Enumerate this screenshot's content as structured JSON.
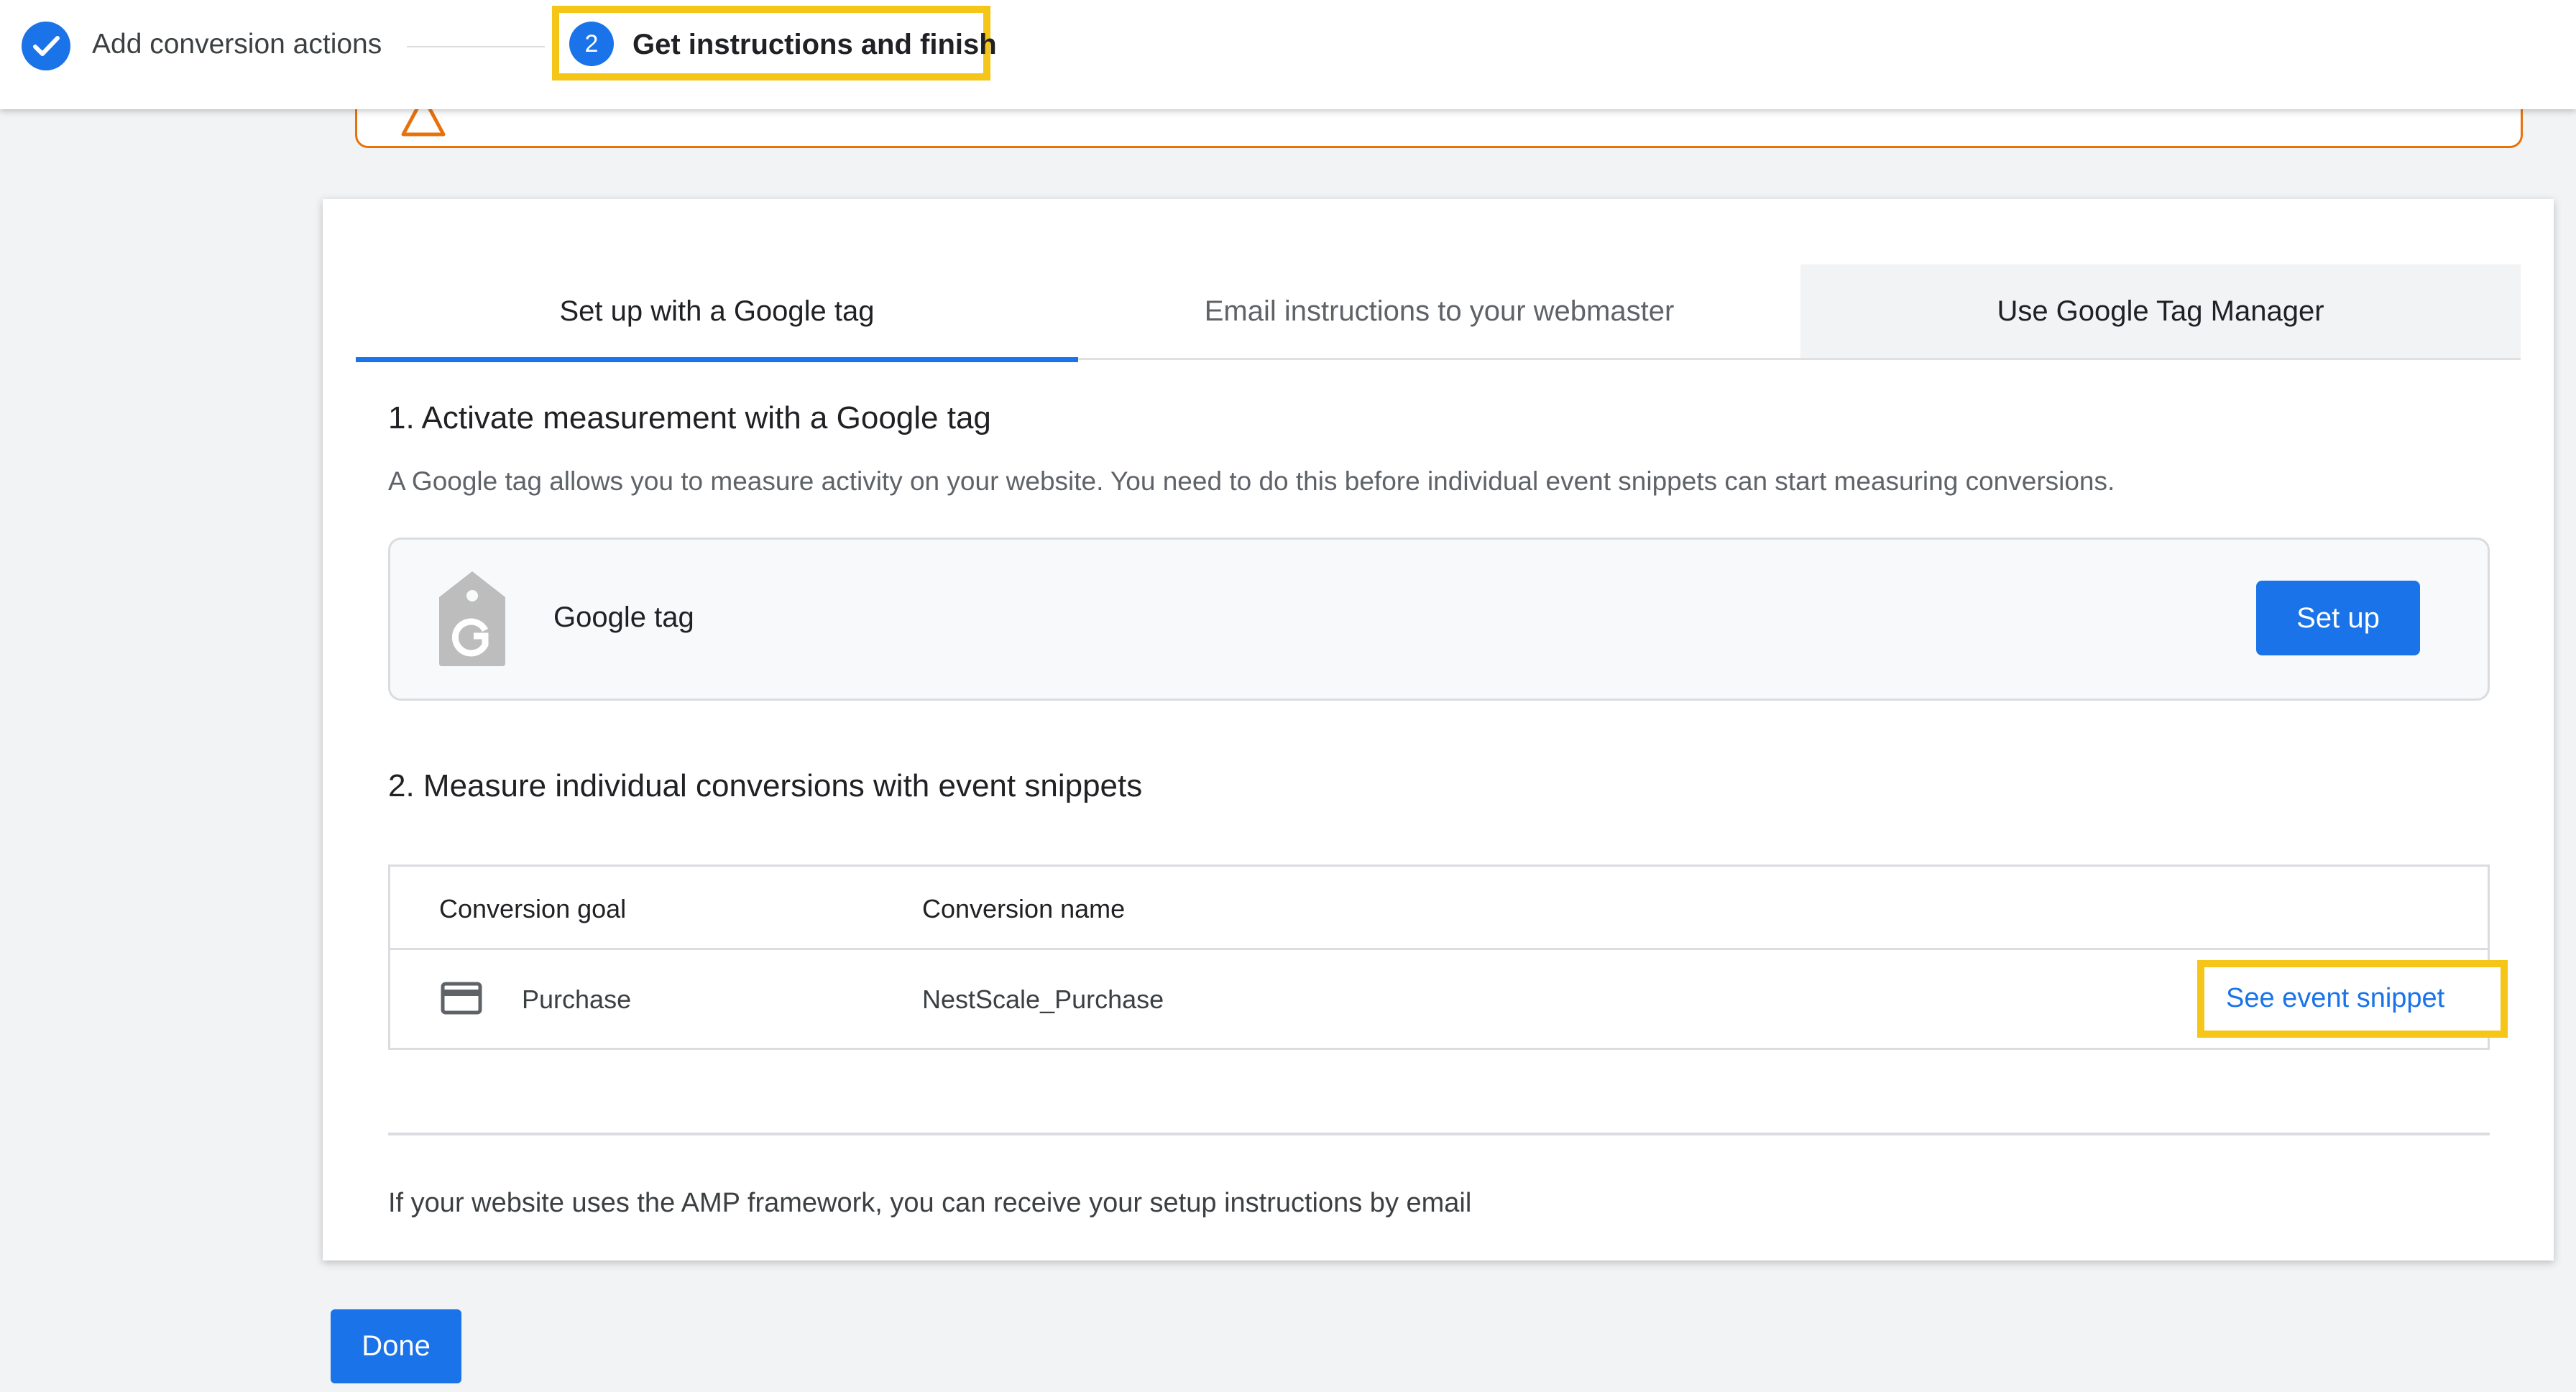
{
  "stepper": {
    "step1_label": "Add conversion actions",
    "step2_number": "2",
    "step2_label": "Get instructions and finish"
  },
  "tabs": [
    {
      "label": "Set up with a Google tag"
    },
    {
      "label": "Email instructions to your webmaster"
    },
    {
      "label": "Use Google Tag Manager"
    }
  ],
  "section1": {
    "heading": "1. Activate measurement with a Google tag",
    "description": "A Google tag allows you to measure activity on your website. You need to do this before individual event snippets can start measuring conversions.",
    "tag_label": "Google tag",
    "setup_button": "Set up"
  },
  "section2": {
    "heading": "2. Measure individual conversions with event snippets",
    "columns": [
      "Conversion goal",
      "Conversion name"
    ],
    "rows": [
      {
        "goal": "Purchase",
        "name": "NestScale_Purchase",
        "action": "See event snippet",
        "icon": "credit-card-icon"
      }
    ]
  },
  "amp_note": "If your website uses the AMP framework, you can receive your setup instructions by email",
  "done_button": "Done",
  "colors": {
    "accent": "#1a73e8",
    "highlight": "#f5c518",
    "warning": "#e8710a"
  }
}
